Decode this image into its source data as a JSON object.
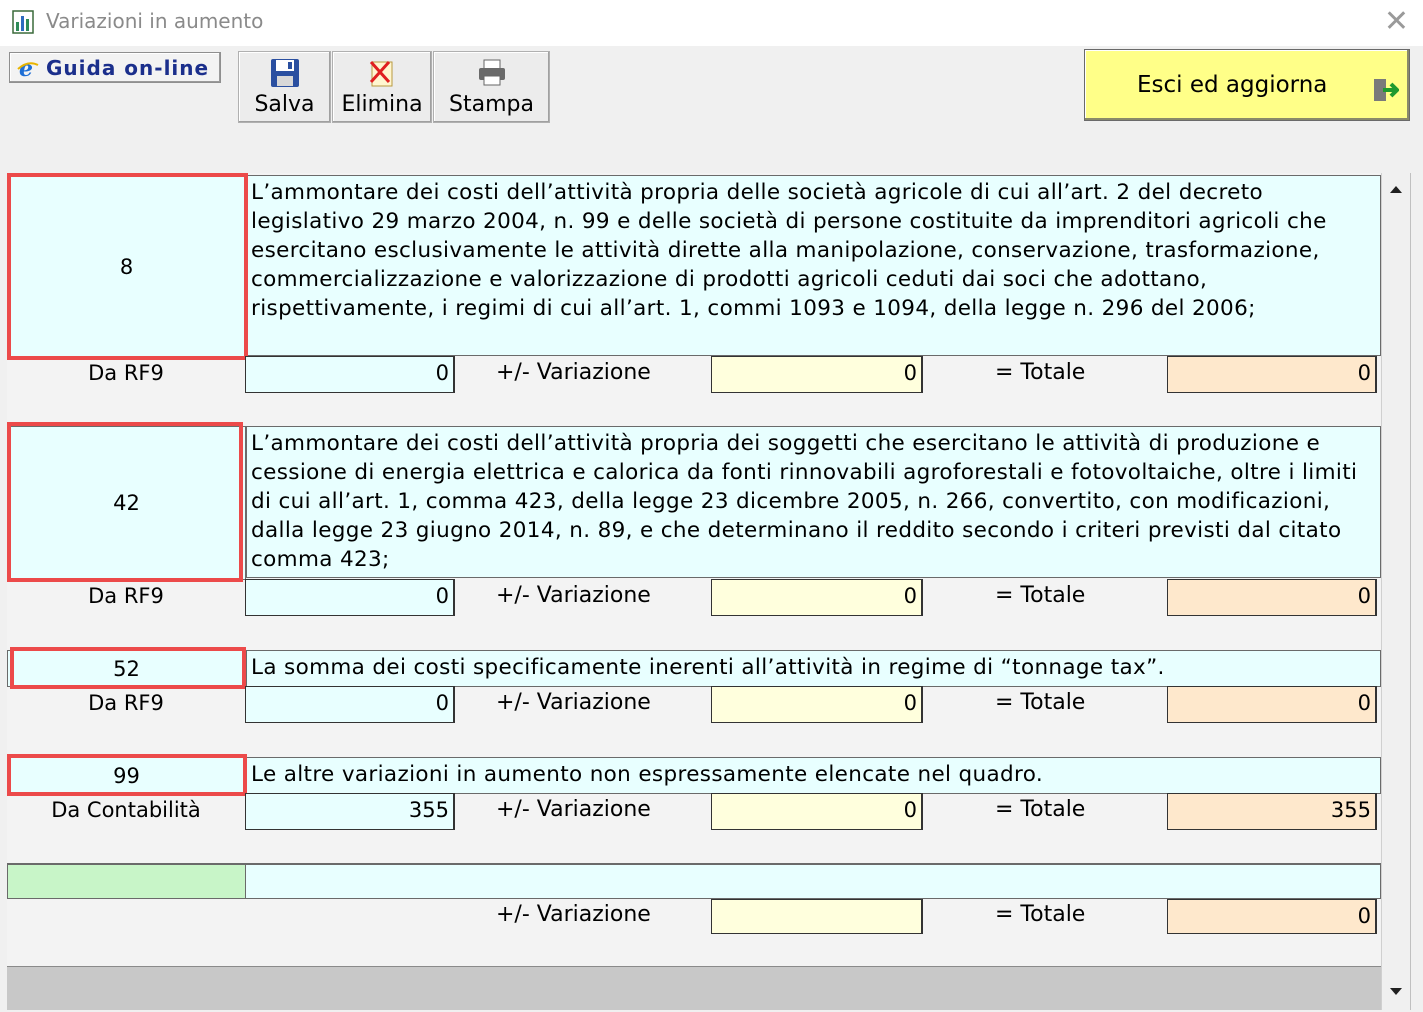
{
  "window": {
    "title": "Variazioni in aumento",
    "close_icon": "close-icon"
  },
  "toolbar": {
    "guida_label": "Guida on-line",
    "save_label": "Salva",
    "delete_label": "Elimina",
    "print_label": "Stampa",
    "exit_label": "Esci ed aggiorna"
  },
  "colors": {
    "accent_red": "#ec4a4a",
    "field_cyan": "#e8ffff",
    "field_yellow": "#ffffdd",
    "field_peach": "#fee8cc",
    "exit_yellow": "#ffff88",
    "green": "#c8f5c8"
  },
  "labels": {
    "variazione": "+/- Variazione",
    "totale": "= Totale"
  },
  "rows": [
    {
      "code": "8",
      "description": "L’ammontare dei costi dell’attività propria delle società agricole di cui all’art. 2 del decreto legislativo 29 marzo 2004, n. 99 e delle società di persone costituite da imprenditori agricoli che esercitano esclusivamente le attività dirette alla manipolazione, conservazione, trasformazione, commercializzazione e valorizzazione di prodotti agricoli ceduti dai soci che adottano, rispettivamente, i regimi di cui all’art. 1, commi 1093 e 1094, della legge n. 296 del 2006;",
      "source_label": "Da RF9",
      "source_value": "0",
      "variazione_value": "0",
      "totale_value": "0"
    },
    {
      "code": "42",
      "description": "L’ammontare dei costi dell’attività propria dei soggetti che esercitano le attività di produzione e cessione di energia elettrica e calorica da fonti rinnovabili agroforestali e fotovoltaiche, oltre i limiti di cui all’art. 1, comma 423, della legge 23 dicembre 2005, n. 266, convertito, con modificazioni, dalla legge 23 giugno 2014, n. 89, e che determinano il reddito secondo i criteri previsti dal citato comma 423;",
      "source_label": "Da RF9",
      "source_value": "0",
      "variazione_value": "0",
      "totale_value": "0"
    },
    {
      "code": "52",
      "description": "La somma dei costi specificamente inerenti all’attività in regime di “tonnage tax”.",
      "source_label": "Da RF9",
      "source_value": "0",
      "variazione_value": "0",
      "totale_value": "0"
    },
    {
      "code": "99",
      "description": "Le altre variazioni in aumento non espressamente elencate nel quadro.",
      "source_label": "Da Contabilità",
      "source_value": "355",
      "variazione_value": "0",
      "totale_value": "355"
    }
  ],
  "extra_row": {
    "code": "",
    "description": "",
    "variazione_value": "",
    "totale_value": "0"
  }
}
